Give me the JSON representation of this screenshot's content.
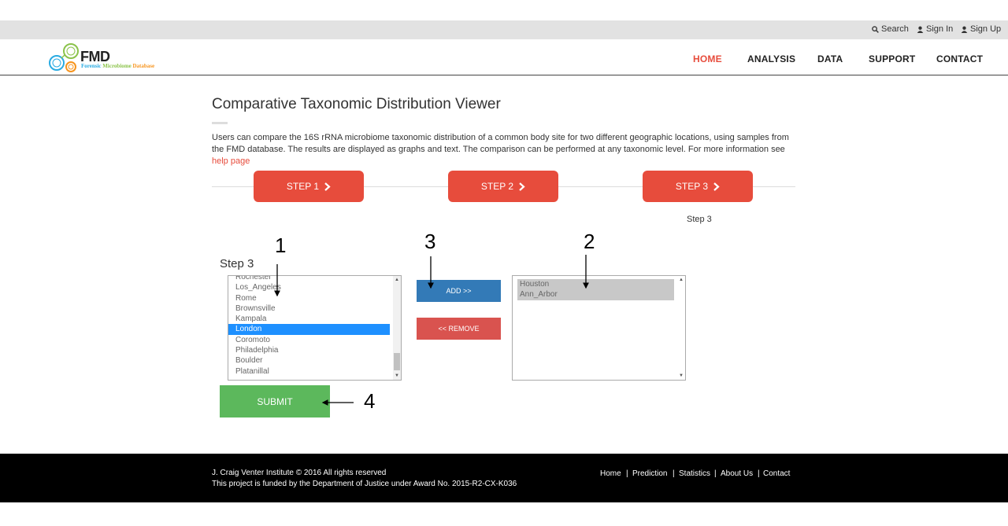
{
  "topbar": {
    "search_label": "Search",
    "signin_label": "Sign In",
    "signup_label": "Sign Up"
  },
  "logo": {
    "name": "FMD",
    "subtitle_word1": "Forensic",
    "subtitle_word2": "Microbiome",
    "subtitle_word3": "Database"
  },
  "nav": {
    "home": "HOME",
    "analysis": "ANALYSIS",
    "data": "DATA",
    "support": "SUPPORT",
    "contact": "CONTACT"
  },
  "page": {
    "title": "Comparative Taxonomic Distribution Viewer",
    "description": "Users can compare the 16S rRNA microbiome taxonomic distribution of a common body site for two different geographic locations, using samples from the FMD database. The results are displayed as graphs and text. The comparison can be performed at any taxonomic level. For more information see ",
    "help_link": "help page"
  },
  "steps": {
    "step1": "STEP 1",
    "step2": "STEP 2",
    "step3": "STEP 3",
    "step3_caption": "Step 3"
  },
  "form": {
    "heading": "Step 3",
    "available_locations": [
      "Rochester",
      "Los_Angeles",
      "Rome",
      "Brownsville",
      "Kampala",
      "London",
      "Coromoto",
      "Philadelphia",
      "Boulder",
      "Platanillal"
    ],
    "selected_available": "London",
    "chosen_locations": [
      "Houston",
      "Ann_Arbor"
    ],
    "add_label": "ADD >>",
    "remove_label": "<< REMOVE",
    "submit_label": "SUBMIT"
  },
  "callouts": {
    "c1": "1",
    "c2": "2",
    "c3": "3",
    "c4": "4"
  },
  "footer": {
    "copyright": "J. Craig Venter Institute © 2016 All rights reserved",
    "funding": "This project is funded by the Department of Justice under Award No. 2015-R2-CX-K036",
    "links": [
      "Home",
      "Prediction",
      "Statistics",
      "About Us",
      "Contact"
    ]
  },
  "colors": {
    "accent": "#e74c3c",
    "add_button": "#337ab7",
    "remove_button": "#d9534f",
    "submit_button": "#5cb85c",
    "selection": "#1e90ff"
  }
}
